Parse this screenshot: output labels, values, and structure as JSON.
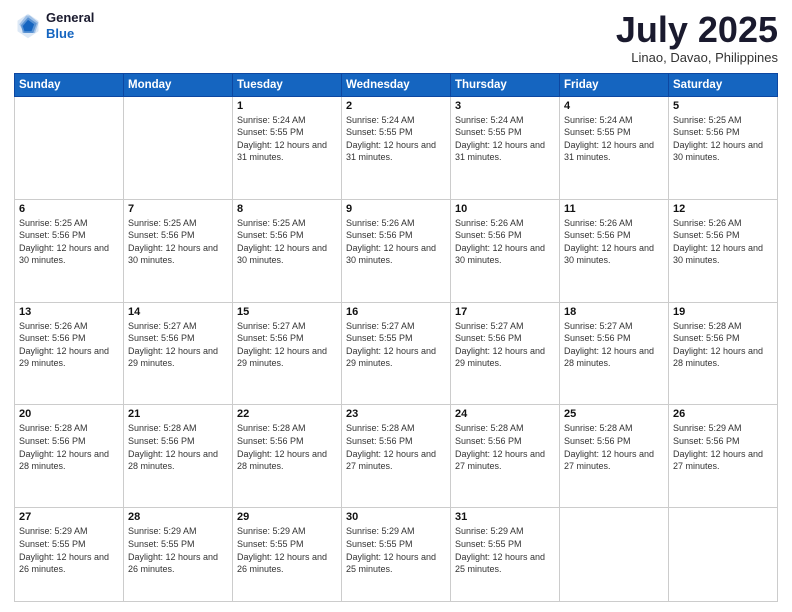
{
  "header": {
    "logo_general": "General",
    "logo_blue": "Blue",
    "month_title": "July 2025",
    "location": "Linao, Davao, Philippines"
  },
  "weekdays": [
    "Sunday",
    "Monday",
    "Tuesday",
    "Wednesday",
    "Thursday",
    "Friday",
    "Saturday"
  ],
  "weeks": [
    [
      {
        "day": "",
        "info": ""
      },
      {
        "day": "",
        "info": ""
      },
      {
        "day": "1",
        "info": "Sunrise: 5:24 AM\nSunset: 5:55 PM\nDaylight: 12 hours and 31 minutes."
      },
      {
        "day": "2",
        "info": "Sunrise: 5:24 AM\nSunset: 5:55 PM\nDaylight: 12 hours and 31 minutes."
      },
      {
        "day": "3",
        "info": "Sunrise: 5:24 AM\nSunset: 5:55 PM\nDaylight: 12 hours and 31 minutes."
      },
      {
        "day": "4",
        "info": "Sunrise: 5:24 AM\nSunset: 5:55 PM\nDaylight: 12 hours and 31 minutes."
      },
      {
        "day": "5",
        "info": "Sunrise: 5:25 AM\nSunset: 5:56 PM\nDaylight: 12 hours and 30 minutes."
      }
    ],
    [
      {
        "day": "6",
        "info": "Sunrise: 5:25 AM\nSunset: 5:56 PM\nDaylight: 12 hours and 30 minutes."
      },
      {
        "day": "7",
        "info": "Sunrise: 5:25 AM\nSunset: 5:56 PM\nDaylight: 12 hours and 30 minutes."
      },
      {
        "day": "8",
        "info": "Sunrise: 5:25 AM\nSunset: 5:56 PM\nDaylight: 12 hours and 30 minutes."
      },
      {
        "day": "9",
        "info": "Sunrise: 5:26 AM\nSunset: 5:56 PM\nDaylight: 12 hours and 30 minutes."
      },
      {
        "day": "10",
        "info": "Sunrise: 5:26 AM\nSunset: 5:56 PM\nDaylight: 12 hours and 30 minutes."
      },
      {
        "day": "11",
        "info": "Sunrise: 5:26 AM\nSunset: 5:56 PM\nDaylight: 12 hours and 30 minutes."
      },
      {
        "day": "12",
        "info": "Sunrise: 5:26 AM\nSunset: 5:56 PM\nDaylight: 12 hours and 30 minutes."
      }
    ],
    [
      {
        "day": "13",
        "info": "Sunrise: 5:26 AM\nSunset: 5:56 PM\nDaylight: 12 hours and 29 minutes."
      },
      {
        "day": "14",
        "info": "Sunrise: 5:27 AM\nSunset: 5:56 PM\nDaylight: 12 hours and 29 minutes."
      },
      {
        "day": "15",
        "info": "Sunrise: 5:27 AM\nSunset: 5:56 PM\nDaylight: 12 hours and 29 minutes."
      },
      {
        "day": "16",
        "info": "Sunrise: 5:27 AM\nSunset: 5:55 PM\nDaylight: 12 hours and 29 minutes."
      },
      {
        "day": "17",
        "info": "Sunrise: 5:27 AM\nSunset: 5:56 PM\nDaylight: 12 hours and 29 minutes."
      },
      {
        "day": "18",
        "info": "Sunrise: 5:27 AM\nSunset: 5:56 PM\nDaylight: 12 hours and 28 minutes."
      },
      {
        "day": "19",
        "info": "Sunrise: 5:28 AM\nSunset: 5:56 PM\nDaylight: 12 hours and 28 minutes."
      }
    ],
    [
      {
        "day": "20",
        "info": "Sunrise: 5:28 AM\nSunset: 5:56 PM\nDaylight: 12 hours and 28 minutes."
      },
      {
        "day": "21",
        "info": "Sunrise: 5:28 AM\nSunset: 5:56 PM\nDaylight: 12 hours and 28 minutes."
      },
      {
        "day": "22",
        "info": "Sunrise: 5:28 AM\nSunset: 5:56 PM\nDaylight: 12 hours and 28 minutes."
      },
      {
        "day": "23",
        "info": "Sunrise: 5:28 AM\nSunset: 5:56 PM\nDaylight: 12 hours and 27 minutes."
      },
      {
        "day": "24",
        "info": "Sunrise: 5:28 AM\nSunset: 5:56 PM\nDaylight: 12 hours and 27 minutes."
      },
      {
        "day": "25",
        "info": "Sunrise: 5:28 AM\nSunset: 5:56 PM\nDaylight: 12 hours and 27 minutes."
      },
      {
        "day": "26",
        "info": "Sunrise: 5:29 AM\nSunset: 5:56 PM\nDaylight: 12 hours and 27 minutes."
      }
    ],
    [
      {
        "day": "27",
        "info": "Sunrise: 5:29 AM\nSunset: 5:55 PM\nDaylight: 12 hours and 26 minutes."
      },
      {
        "day": "28",
        "info": "Sunrise: 5:29 AM\nSunset: 5:55 PM\nDaylight: 12 hours and 26 minutes."
      },
      {
        "day": "29",
        "info": "Sunrise: 5:29 AM\nSunset: 5:55 PM\nDaylight: 12 hours and 26 minutes."
      },
      {
        "day": "30",
        "info": "Sunrise: 5:29 AM\nSunset: 5:55 PM\nDaylight: 12 hours and 25 minutes."
      },
      {
        "day": "31",
        "info": "Sunrise: 5:29 AM\nSunset: 5:55 PM\nDaylight: 12 hours and 25 minutes."
      },
      {
        "day": "",
        "info": ""
      },
      {
        "day": "",
        "info": ""
      }
    ]
  ]
}
